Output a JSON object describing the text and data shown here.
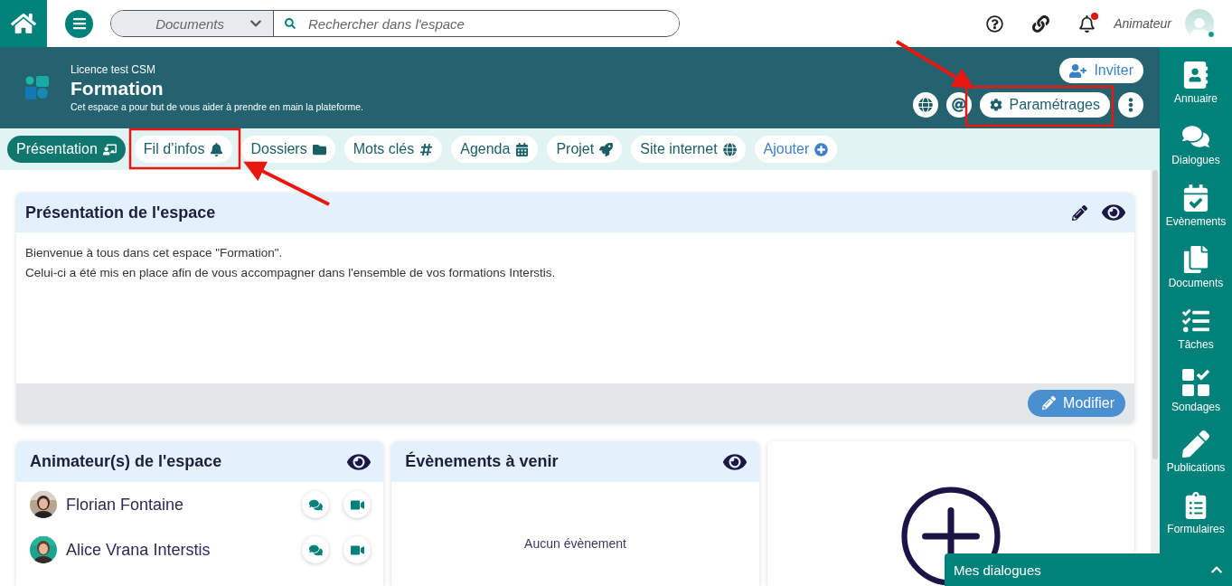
{
  "topbar": {
    "scope": "Documents",
    "search": {
      "placeholder": "Rechercher dans l'espace"
    },
    "user": "Animateur",
    "unread_notifications": true
  },
  "space": {
    "license": "Licence test CSM",
    "title": "Formation",
    "description": "Cet espace a pour but de vous aider à prendre en main la plateforme.",
    "invite": "Inviter",
    "settings": "Paramétrages"
  },
  "tabs": [
    {
      "label": "Présentation",
      "selected": true,
      "kind": "page"
    },
    {
      "label": "Fil d’infos",
      "selected": false,
      "kind": "page"
    },
    {
      "label": "Dossiers",
      "selected": false,
      "kind": "page"
    },
    {
      "label": "Mots clés",
      "selected": false,
      "kind": "page"
    },
    {
      "label": "Agenda",
      "selected": false,
      "kind": "page"
    },
    {
      "label": "Projet",
      "selected": false,
      "kind": "page"
    },
    {
      "label": "Site internet",
      "selected": false,
      "kind": "page"
    },
    {
      "label": "Ajouter",
      "selected": false,
      "kind": "add"
    }
  ],
  "presentation": {
    "title": "Présentation de l'espace",
    "paragraphs": [
      "Bienvenue à tous dans cet espace \"Formation\".",
      "Celui-ci a été mis en place afin de vous accompagner dans l'ensemble de vos formations Interstis."
    ],
    "edit_button": "Modifier"
  },
  "animators": {
    "title": "Animateur(s) de l'espace",
    "members": [
      {
        "name": "Florian Fontaine"
      },
      {
        "name": "Alice Vrana Interstis"
      }
    ]
  },
  "events": {
    "title": "Évènements à venir",
    "empty": "Aucun évènement"
  },
  "sidebar": {
    "items": [
      {
        "label": "Annuaire"
      },
      {
        "label": "Dialogues"
      },
      {
        "label": "Evènements"
      },
      {
        "label": "Documents"
      },
      {
        "label": "Tâches"
      },
      {
        "label": "Sondages"
      },
      {
        "label": "Publications"
      },
      {
        "label": "Formulaires"
      }
    ]
  },
  "chat_bar": {
    "title": "Mes dialogues"
  }
}
